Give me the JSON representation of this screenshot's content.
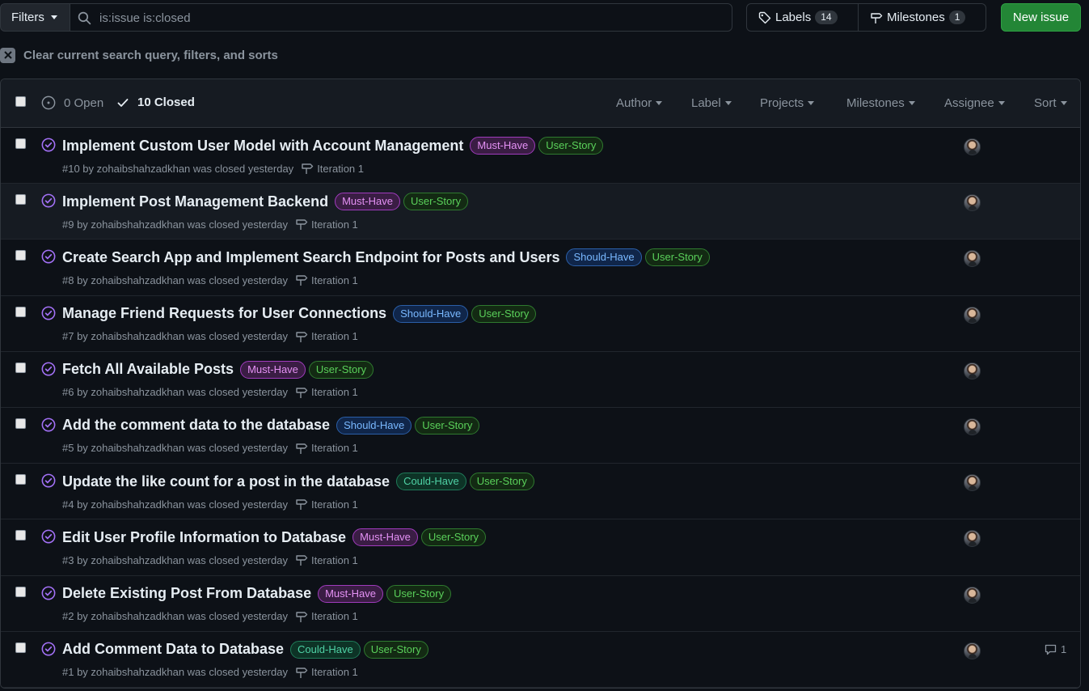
{
  "toolbar": {
    "filters_label": "Filters",
    "search_value": "is:issue is:closed",
    "labels_label": "Labels",
    "labels_count": "14",
    "milestones_label": "Milestones",
    "milestones_count": "1",
    "new_issue_label": "New issue"
  },
  "clear_query": {
    "label": "Clear current search query, filters, and sorts"
  },
  "list_header": {
    "open_label": "0 Open",
    "closed_label": "10 Closed",
    "menus": [
      "Author",
      "Label",
      "Projects",
      "Milestones",
      "Assignee",
      "Sort"
    ]
  },
  "label_colors": {
    "Must-Have": {
      "fg": "#e491f4",
      "bg": "#3a1d44",
      "border": "#a03bbd"
    },
    "Should-Have": {
      "fg": "#79b8ff",
      "bg": "#10264a",
      "border": "#2b5fa8"
    },
    "Could-Have": {
      "fg": "#4fd1a5",
      "bg": "#0d3326",
      "border": "#1f7a58"
    },
    "User-Story": {
      "fg": "#5ad05a",
      "bg": "#132a13",
      "border": "#2f7a2f"
    }
  },
  "issues": [
    {
      "title": "Implement Custom User Model with Account Management",
      "labels": [
        "Must-Have",
        "User-Story"
      ],
      "meta": "#10 by zohaibshahzadkhan was closed yesterday",
      "milestone": "Iteration 1",
      "comments": ""
    },
    {
      "title": "Implement Post Management Backend",
      "labels": [
        "Must-Have",
        "User-Story"
      ],
      "meta": "#9 by zohaibshahzadkhan was closed yesterday",
      "milestone": "Iteration 1",
      "comments": ""
    },
    {
      "title": "Create Search App and Implement Search Endpoint for Posts and Users",
      "labels": [
        "Should-Have",
        "User-Story"
      ],
      "meta": "#8 by zohaibshahzadkhan was closed yesterday",
      "milestone": "Iteration 1",
      "comments": ""
    },
    {
      "title": "Manage Friend Requests for User Connections",
      "labels": [
        "Should-Have",
        "User-Story"
      ],
      "meta": "#7 by zohaibshahzadkhan was closed yesterday",
      "milestone": "Iteration 1",
      "comments": ""
    },
    {
      "title": "Fetch All Available Posts",
      "labels": [
        "Must-Have",
        "User-Story"
      ],
      "meta": "#6 by zohaibshahzadkhan was closed yesterday",
      "milestone": "Iteration 1",
      "comments": ""
    },
    {
      "title": "Add the comment data to the database",
      "labels": [
        "Should-Have",
        "User-Story"
      ],
      "meta": "#5 by zohaibshahzadkhan was closed yesterday",
      "milestone": "Iteration 1",
      "comments": ""
    },
    {
      "title": "Update the like count for a post in the database",
      "labels": [
        "Could-Have",
        "User-Story"
      ],
      "meta": "#4 by zohaibshahzadkhan was closed yesterday",
      "milestone": "Iteration 1",
      "comments": ""
    },
    {
      "title": "Edit User Profile Information to Database",
      "labels": [
        "Must-Have",
        "User-Story"
      ],
      "meta": "#3 by zohaibshahzadkhan was closed yesterday",
      "milestone": "Iteration 1",
      "comments": ""
    },
    {
      "title": "Delete Existing Post From Database",
      "labels": [
        "Must-Have",
        "User-Story"
      ],
      "meta": "#2 by zohaibshahzadkhan was closed yesterday",
      "milestone": "Iteration 1",
      "comments": ""
    },
    {
      "title": "Add Comment Data to Database",
      "labels": [
        "Could-Have",
        "User-Story"
      ],
      "meta": "#1 by zohaibshahzadkhan was closed yesterday",
      "milestone": "Iteration 1",
      "comments": "1"
    }
  ]
}
